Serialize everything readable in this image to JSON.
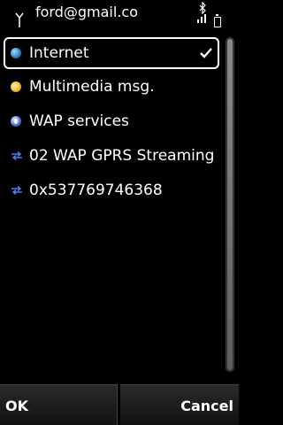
{
  "status_bar": {
    "title": "ford@gmail.co",
    "icons": [
      "antenna-icon",
      "bluetooth-icon",
      "signal-icon",
      "battery-icon"
    ]
  },
  "list": {
    "items": [
      {
        "label": "Internet",
        "icon": "globe-icon",
        "selected": true
      },
      {
        "label": "Multimedia msg.",
        "icon": "mms-icon",
        "selected": false
      },
      {
        "label": "WAP services",
        "icon": "wap-icon",
        "selected": false
      },
      {
        "label": "02 WAP GPRS Streaming",
        "icon": "data-arrows-icon",
        "selected": false
      },
      {
        "label": "0x537769746368",
        "icon": "data-arrows-icon",
        "selected": false
      }
    ]
  },
  "scrollbar": {
    "position": 0.0,
    "visible_fraction": 1.0
  },
  "softkeys": {
    "left": "OK",
    "right": "Cancel"
  },
  "colors": {
    "background": "#000000",
    "text": "#ffffff",
    "arrows": "#4a7ff0"
  }
}
